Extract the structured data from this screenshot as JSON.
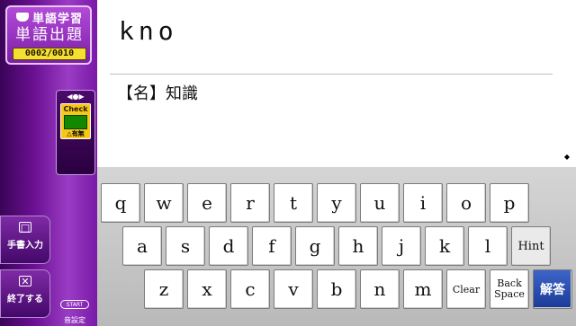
{
  "app": {
    "brand": "単語学習",
    "mode": "単語出題",
    "counter": "0002/0010"
  },
  "check_panel": {
    "label": "Check",
    "toggle_label": "有無"
  },
  "side_buttons": {
    "handwrite": {
      "symbol": "□",
      "label": "手書入力"
    },
    "quit": {
      "symbol": "✕",
      "label": "終了する"
    },
    "start": {
      "button": "START",
      "label": "音設定"
    }
  },
  "display": {
    "answer_text": "kno",
    "meaning": "【名】知識"
  },
  "keyboard": {
    "row1": [
      "q",
      "w",
      "e",
      "r",
      "t",
      "y",
      "u",
      "i",
      "o",
      "p"
    ],
    "row2": [
      "a",
      "s",
      "d",
      "f",
      "g",
      "h",
      "j",
      "k",
      "l"
    ],
    "row3": [
      "z",
      "x",
      "c",
      "v",
      "b",
      "n",
      "m"
    ],
    "hint": "Hint",
    "clear": "Clear",
    "backspace": [
      "Back",
      "Space"
    ],
    "submit": "解答"
  },
  "colors": {
    "sidebar": "#7a1aa8",
    "counter_bg": "#f4e030",
    "submit_key": "#2a4cb4"
  }
}
